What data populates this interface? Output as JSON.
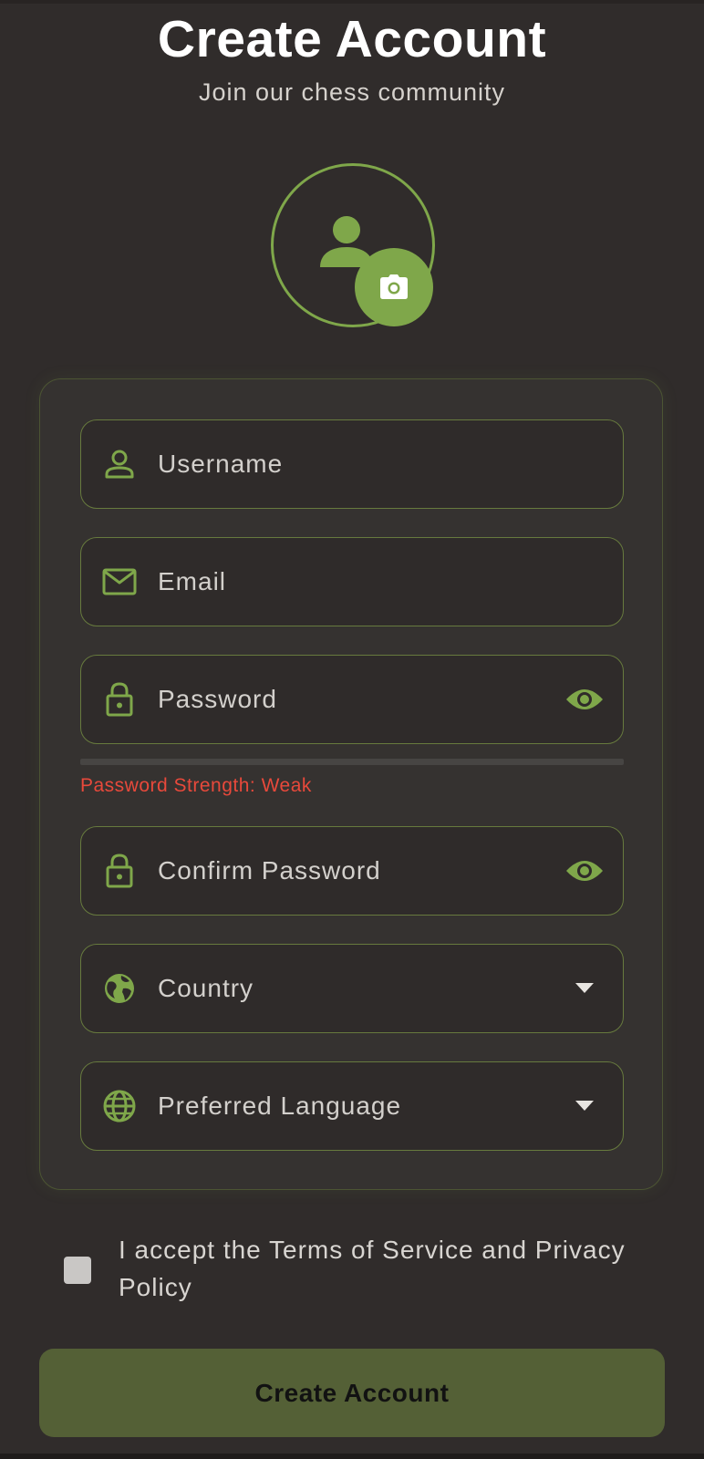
{
  "header": {
    "title": "Create Account",
    "subtitle": "Join our chess community"
  },
  "avatar": {
    "icon": "person-icon",
    "action_icon": "camera-icon"
  },
  "form": {
    "fields": [
      {
        "key": "username",
        "label": "Username",
        "icon": "person-outline-icon"
      },
      {
        "key": "email",
        "label": "Email",
        "icon": "mail-icon"
      },
      {
        "key": "password",
        "label": "Password",
        "icon": "lock-icon",
        "trailing_icon": "eye-icon"
      },
      {
        "key": "confirm_password",
        "label": "Confirm Password",
        "icon": "lock-icon",
        "trailing_icon": "eye-icon"
      },
      {
        "key": "country",
        "label": "Country",
        "icon": "public-globe-icon",
        "trailing_icon": "dropdown-arrow-icon"
      },
      {
        "key": "language",
        "label": "Preferred Language",
        "icon": "language-globe-icon",
        "trailing_icon": "dropdown-arrow-icon"
      }
    ],
    "password_strength": {
      "text": "Password Strength: Weak",
      "level": 0
    }
  },
  "terms": {
    "label": "I accept the Terms of Service and Privacy Policy",
    "checked": false
  },
  "submit": {
    "label": "Create Account"
  },
  "colors": {
    "background": "#302c2b",
    "accent": "#7fa74a",
    "field_border": "#677a3e",
    "error": "#e8493b",
    "button": "#546036"
  }
}
